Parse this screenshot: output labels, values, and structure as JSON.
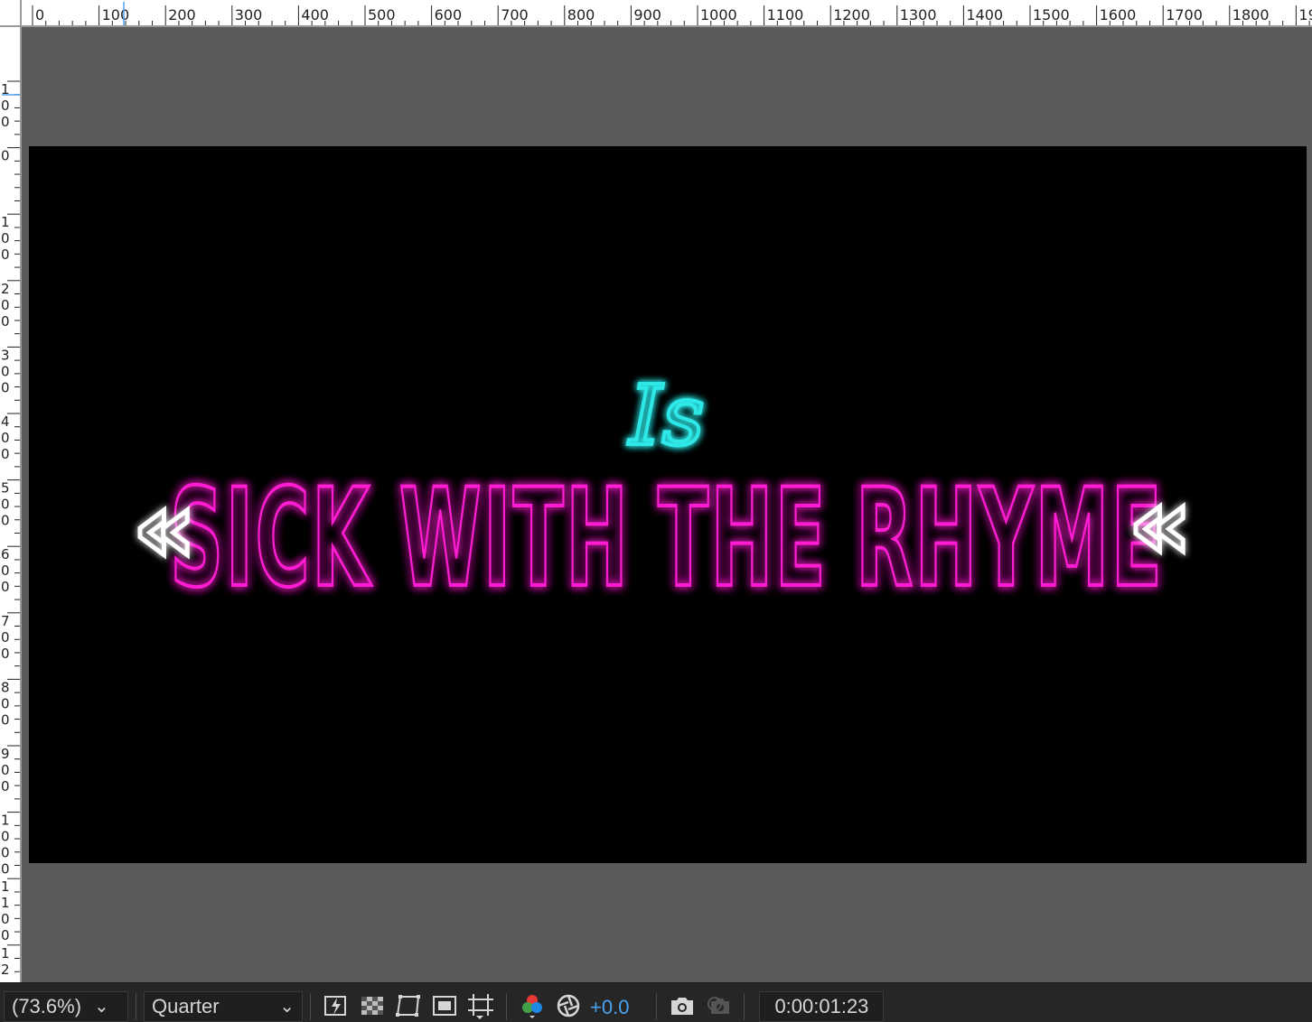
{
  "rulers": {
    "top_labels": [
      "0",
      "100",
      "200",
      "300",
      "400",
      "500",
      "600",
      "700",
      "800",
      "900",
      "1000",
      "1100",
      "1200",
      "1300",
      "1400",
      "1500",
      "1600",
      "1700",
      "1800",
      "19"
    ],
    "left_labels": [
      "1\n0\n0",
      "0",
      "1\n0\n0",
      "2\n0\n0",
      "3\n0\n0",
      "4\n0\n0",
      "5\n0\n0",
      "6\n0\n0",
      "7\n0\n0",
      "8\n0\n0",
      "9\n0\n0",
      "1\n0\n0\n0",
      "1\n1\n0\n0",
      "1\n2"
    ]
  },
  "composition": {
    "background_color": "#000000",
    "small_text": "Is",
    "small_text_color": "#2fe8e8",
    "main_text": "SICK WITH THE RHYME",
    "main_text_color": "#ff1fd2",
    "arrow_left_glyph": "«",
    "arrow_right_glyph": "«",
    "arrow_color": "#ffffff"
  },
  "bottom_bar": {
    "zoom_value": "(73.6%)",
    "resolution_value": "Quarter",
    "exposure_value": "+0.0",
    "timecode": "0:00:01:23",
    "icons": [
      "fast-preview-icon",
      "transparency-grid-icon",
      "mask-path-icon",
      "region-of-interest-icon",
      "guides-grid-icon",
      "channel-rgb-icon",
      "exposure-shutter-icon",
      "snapshot-camera-icon",
      "show-snapshot-icon"
    ],
    "accent_color": "#4aa3f0"
  }
}
